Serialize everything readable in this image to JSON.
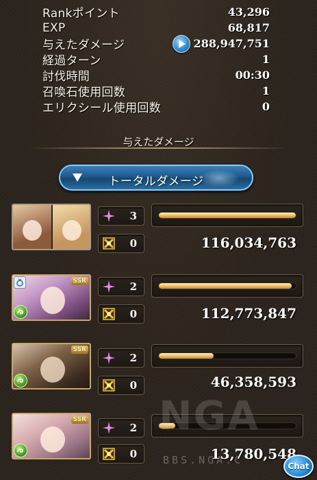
{
  "stats": [
    {
      "label": "Rankポイント",
      "value": "43,296"
    },
    {
      "label": "EXP",
      "value": "68,817"
    },
    {
      "label": "与えたダメージ",
      "value": "288,947,751",
      "has_play_icon": true
    },
    {
      "label": "経過ターン",
      "value": "1"
    },
    {
      "label": "討伐時間",
      "value": "00:30"
    },
    {
      "label": "召喚石使用回数",
      "value": "1"
    },
    {
      "label": "エリクシール使用回数",
      "value": "0"
    }
  ],
  "section_title": "与えたダメージ",
  "dropdown": {
    "label": "トータルダメージ"
  },
  "characters": [
    {
      "skill_count": "3",
      "ougi_count": "0",
      "damage": "116,034,763",
      "bar_fraction": 1.0,
      "portrait": "main-character-pair"
    },
    {
      "skill_count": "2",
      "ougi_count": "0",
      "damage": "112,773,847",
      "bar_fraction": 0.97,
      "portrait": "ssr-character-wind-1",
      "badge": "SSR",
      "element": "wind"
    },
    {
      "skill_count": "2",
      "ougi_count": "0",
      "damage": "46,358,593",
      "bar_fraction": 0.4,
      "portrait": "ssr-character-wind-2",
      "badge": "SSR",
      "element": "wind"
    },
    {
      "skill_count": "2",
      "ougi_count": "0",
      "damage": "13,780,548",
      "bar_fraction": 0.12,
      "portrait": "ssr-character-wind-3",
      "badge": "SSR",
      "element": "wind"
    }
  ],
  "icons": {
    "play": "play-icon",
    "dropdown_arrow": "triangle-down-icon",
    "skill": "sparkle-star-icon",
    "ougi": "ougi-burst-icon",
    "element": "wind-element-icon"
  },
  "watermark": {
    "logo": "NGA",
    "url": "BBS.NGA.C"
  },
  "chat_button": {
    "label": "Chat"
  },
  "colors": {
    "bar_fill": "#f1c672",
    "dropdown": "#1e5a8e",
    "skill_icon": "#e88de8",
    "ougi_icon": "#f1c23c"
  }
}
